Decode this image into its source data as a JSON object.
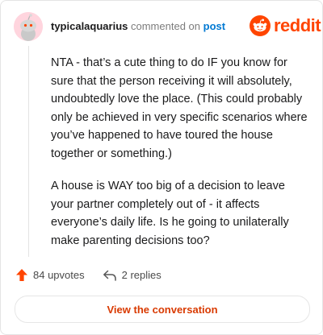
{
  "comment": {
    "username": "typicalaquarius",
    "verb": "commented on",
    "post_link": "post",
    "paragraphs": [
      "NTA - that’s a cute thing to do IF you know for sure that the person receiving it will absolutely, undoubtedly love the place. (This could probably only be achieved in very specific scenarios where you’ve happened to have toured the house together or something.)",
      "A house is WAY too big of a decision to leave your partner completely out of - it affects everyone’s daily life. Is he going to unilaterally make parenting decisions too?"
    ]
  },
  "brand": {
    "name": "reddit",
    "color": "#ff4500"
  },
  "stats": {
    "upvotes": "84 upvotes",
    "replies": "2 replies"
  },
  "cta": {
    "label": "View the conversation"
  }
}
